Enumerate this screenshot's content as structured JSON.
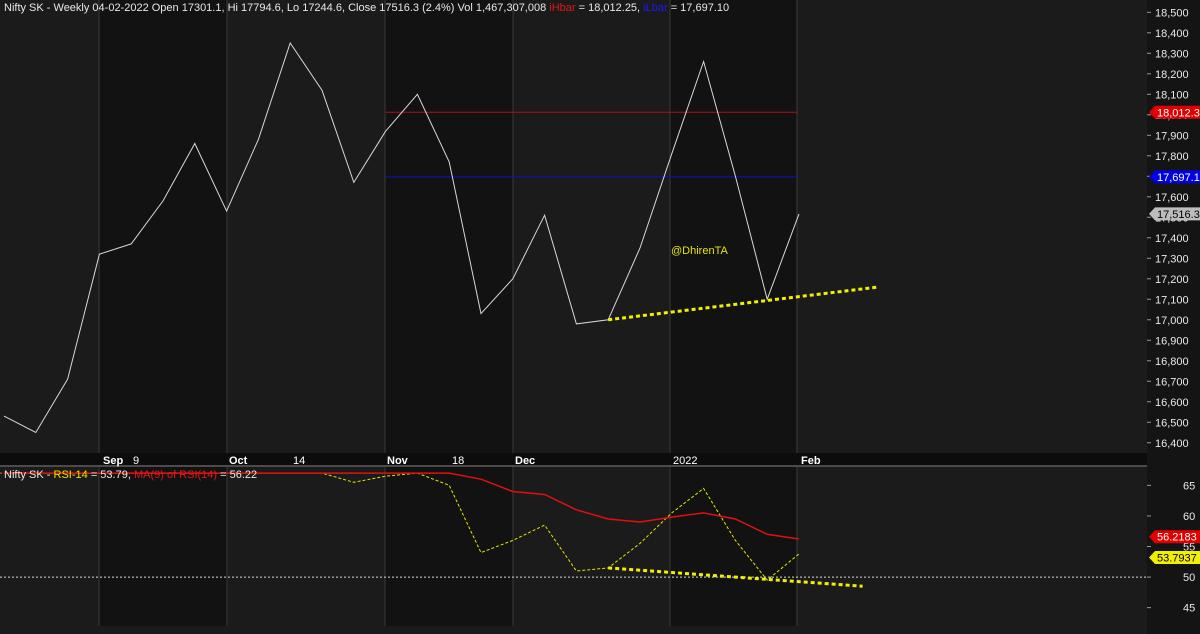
{
  "header": {
    "price_info": "Nifty SK - Weekly 04-02-2022 Open 17301.1, Hi 17794.6, Lo 17244.6, Close 17516.3 (2.4%) Vol 1,467,307,008",
    "hbar_label": "iHbar",
    "hbar_value": " = 18,012.25, ",
    "lbar_label": "iLbar",
    "lbar_value": " = 17,697.10"
  },
  "rsi_header": {
    "prefix": "Nifty SK - ",
    "rsi_label": "RSI-14",
    "rsi_value": " = 53.79, ",
    "ma_label": "MA(9) of RSI(14)",
    "ma_value": " = 56.22"
  },
  "watermark": "@DhirenTA",
  "colors": {
    "background": "#1b1b1b",
    "price_line": "#d8d8d8",
    "hbar": "#b01010",
    "lbar": "#1010c8",
    "trendline": "#f0f000",
    "rsi": "#e6e600",
    "rsi_ma": "#e01010"
  },
  "chart_data": [
    {
      "type": "line",
      "name": "price",
      "x_labels": [
        "Sep",
        "9",
        "Oct",
        "14",
        "Nov",
        "18",
        "Dec",
        "2022",
        "Feb"
      ],
      "values": [
        16530,
        16450,
        16710,
        17320,
        17370,
        17580,
        17860,
        17530,
        17880,
        18350,
        18120,
        17670,
        17920,
        18100,
        17770,
        17030,
        17200,
        17510,
        16980,
        17000,
        17350,
        17810,
        18260,
        17700,
        17100,
        17516.3
      ],
      "y_ticks": [
        "16,400",
        "16,500",
        "16,600",
        "16,700",
        "16,800",
        "16,900",
        "17,000",
        "17,100",
        "17,200",
        "17,300",
        "17,400",
        "17,500",
        "17,600",
        "17,700",
        "17,800",
        "17,900",
        "18,000",
        "18,100",
        "18,200",
        "18,300",
        "18,400",
        "18,500"
      ],
      "ylim": [
        16350,
        18560
      ],
      "hbar": 18012.25,
      "lbar": 17697.1,
      "hbar_tag": "18,012.3",
      "lbar_tag": "17,697.1",
      "last_tag": "17,516.3",
      "trendline": {
        "from": [
          19,
          17000
        ],
        "to": [
          27.5,
          17160
        ]
      }
    },
    {
      "type": "line",
      "name": "RSI-14",
      "series": [
        {
          "name": "RSI-14",
          "values": [
            67,
            67,
            67,
            67,
            67,
            67,
            67,
            67,
            67,
            67,
            67,
            65.5,
            66.5,
            67,
            65,
            54,
            56,
            58.5,
            51,
            51.5,
            55.5,
            60.5,
            64.5,
            56,
            49.5,
            53.79
          ]
        },
        {
          "name": "MA(9) of RSI(14)",
          "values": [
            67,
            67,
            67,
            67,
            67,
            67,
            67,
            67,
            67,
            67,
            67,
            67,
            67,
            67,
            67,
            66,
            64,
            63.5,
            61,
            59.5,
            59,
            59.8,
            60.5,
            59.5,
            57,
            56.22
          ]
        }
      ],
      "y_ticks": [
        "45",
        "50",
        "55",
        "60",
        "65"
      ],
      "ylim": [
        42,
        68
      ],
      "ref_line": 50,
      "ma_tag": "56.2183",
      "rsi_tag": "53.7937",
      "trendline": {
        "from": [
          19,
          51.5
        ],
        "to": [
          27,
          48.5
        ]
      }
    }
  ]
}
